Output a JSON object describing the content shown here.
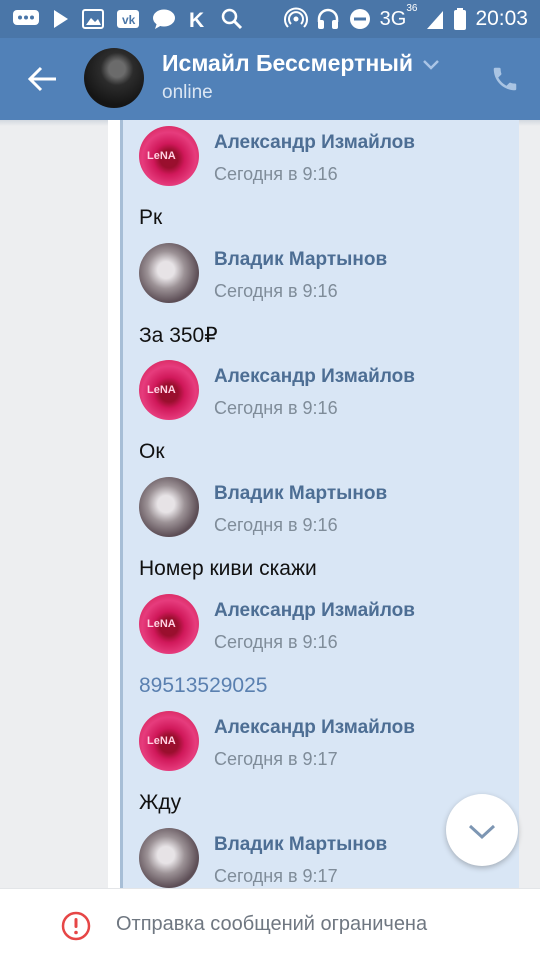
{
  "status_bar": {
    "network": "3G",
    "network_super": "3G",
    "time": "20:03",
    "icons_left": [
      "chat-bubble-icon",
      "play-icon",
      "image-icon",
      "vk-mail-icon",
      "message-icon",
      "k-icon",
      "search-icon"
    ],
    "icons_right": [
      "hotspot-icon",
      "headset-icon",
      "do-not-disturb-icon",
      "signal-icon",
      "battery-icon"
    ]
  },
  "header": {
    "title": "Исмайл Бессмертный",
    "subtitle": "online"
  },
  "messages": [
    {
      "sender": "Александр Измайлов",
      "time": "Сегодня в 9:16",
      "text": "Рк",
      "avatar": "alex"
    },
    {
      "sender": "Владик Мартынов",
      "time": "Сегодня в 9:16",
      "text": "За 350₽",
      "avatar": "vlad"
    },
    {
      "sender": "Александр Измайлов",
      "time": "Сегодня в 9:16",
      "text": "Ок",
      "avatar": "alex"
    },
    {
      "sender": "Владик Мартынов",
      "time": "Сегодня в 9:16",
      "text": "Номер киви скажи",
      "avatar": "vlad"
    },
    {
      "sender": "Александр Измайлов",
      "time": "Сегодня в 9:16",
      "text": "89513529025",
      "avatar": "alex",
      "is_link": true
    },
    {
      "sender": "Александр Измайлов",
      "time": "Сегодня в 9:17",
      "text": "Жду",
      "avatar": "alex"
    },
    {
      "sender": "Владик Мартынов",
      "time": "Сегодня в 9:17",
      "text": "",
      "avatar": "vlad"
    }
  ],
  "footer": {
    "notice": "Отправка сообщений ограничена"
  },
  "colors": {
    "status_bar": "#4a76a8",
    "app_bar": "#5181b8",
    "forward_bg": "#d9e6f5",
    "name": "#4d6e94",
    "link": "#5a80b0",
    "warning": "#e64646"
  }
}
